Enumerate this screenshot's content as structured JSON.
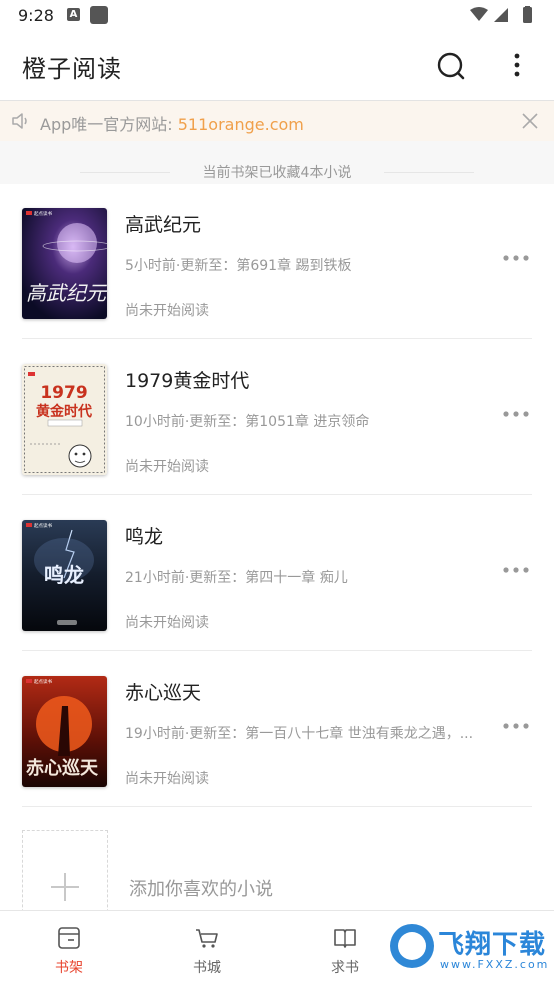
{
  "status_bar": {
    "time": "9:28",
    "badge_letter": "A"
  },
  "app": {
    "title": "橙子阅读"
  },
  "notice": {
    "prefix": "App唯一官方网站: ",
    "link": "511orange.com"
  },
  "shelf_info": "当前书架已收藏4本小说",
  "books": [
    {
      "title": "高武纪元",
      "update": "5小时前·更新至：第691章 踢到铁板",
      "progress": "尚未开始阅读",
      "cover_text": "高武纪元"
    },
    {
      "title": "1979黄金时代",
      "update": "10小时前·更新至：第1051章 进京领命",
      "progress": "尚未开始阅读",
      "cover_text": "1979 黄金时代"
    },
    {
      "title": "鸣龙",
      "update": "21小时前·更新至：第四十一章 痴儿",
      "progress": "尚未开始阅读",
      "cover_text": "鸣龙"
    },
    {
      "title": "赤心巡天",
      "update": "19小时前·更新至：第一百八十七章 世浊有乘龙之遇，...",
      "progress": "尚未开始阅读",
      "cover_text": "赤心巡天"
    }
  ],
  "add_book": {
    "label": "添加你喜欢的小说"
  },
  "nav": [
    {
      "label": "书架",
      "icon": "bookshelf-icon"
    },
    {
      "label": "书城",
      "icon": "store-cart-icon"
    },
    {
      "label": "求书",
      "icon": "request-book-icon"
    }
  ],
  "watermark": {
    "name": "飞翔下载",
    "url": "www.FXXZ.com"
  },
  "colors": {
    "accent": "#e8452f",
    "notice_link": "#f0a04b",
    "notice_bg": "#fbf5ee"
  }
}
